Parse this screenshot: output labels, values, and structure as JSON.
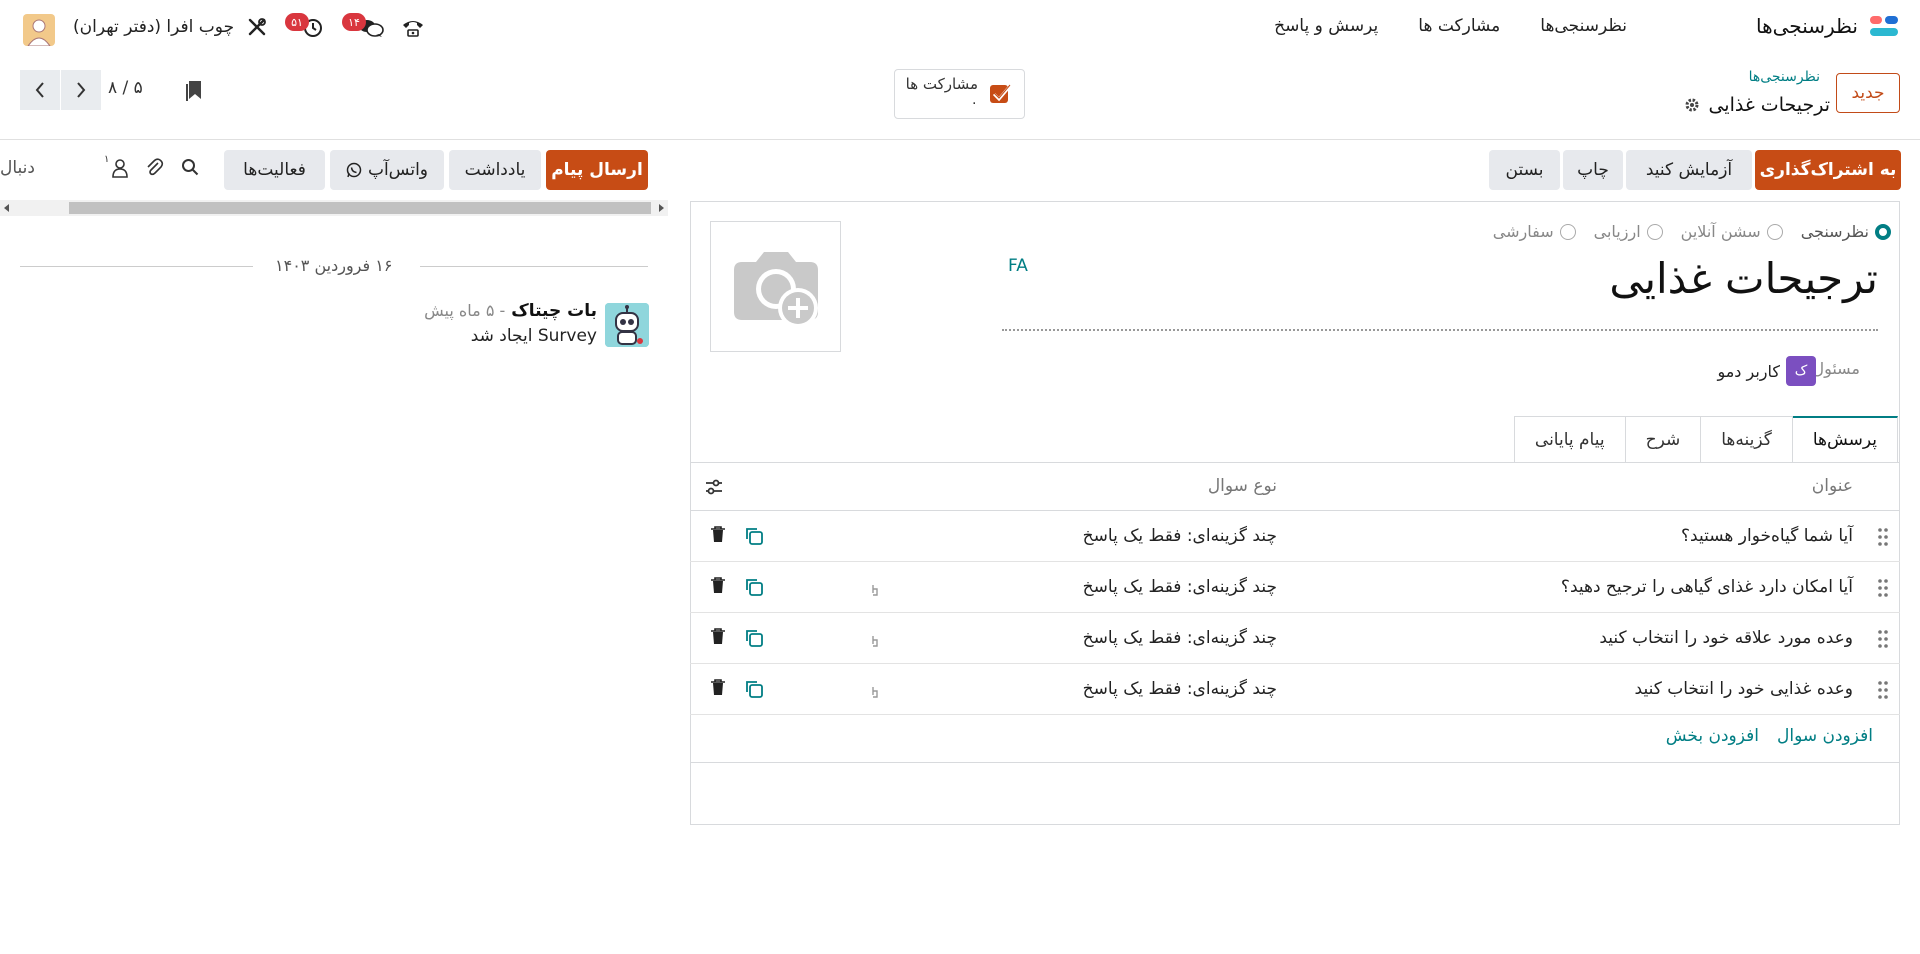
{
  "navbar": {
    "app_name": "نظرسنجی‌ها",
    "menu": [
      "نظرسنجی‌ها",
      "مشارکت ها",
      "پرسش و پاسخ"
    ],
    "company": "چوب افرا (دفتر تهران)",
    "activity_badge": "۵۱",
    "messages_badge": "۱۴"
  },
  "control_panel": {
    "new_button": "جدید",
    "breadcrumb_parent": "نظرسنجی‌ها",
    "breadcrumb_current": "ترجیحات غذایی",
    "stat_label": "مشارکت ها",
    "stat_value": "۰",
    "pager": "۸ / ۵"
  },
  "form_actions": [
    "به اشتراک‌گذاری",
    "آزمایش کنید",
    "چاپ",
    "بستن"
  ],
  "form": {
    "types": [
      {
        "label": "نظرسنجی",
        "selected": true
      },
      {
        "label": "سشن آنلاین",
        "selected": false
      },
      {
        "label": "ارزیابی",
        "selected": false
      },
      {
        "label": "سفارشی",
        "selected": false
      }
    ],
    "title": "ترجیحات غذایی",
    "lang": "FA",
    "responsible_label": "مسئول",
    "responsible_initial": "ک",
    "responsible_name": "کاربر دمو",
    "tabs": [
      "پرسش‌ها",
      "گزینه‌ها",
      "شرح",
      "پیام پایانی"
    ],
    "table": {
      "col_title": "عنوان",
      "col_type": "نوع سوال",
      "rows": [
        {
          "title": "آیا شما گیاه‌خوار هستید؟",
          "type": "چند گزینه‌ای: فقط یک پاسخ"
        },
        {
          "title": "آیا امکان دارد غذای گیاهی را ترجیح دهید؟",
          "type": "چند گزینه‌ای: فقط یک پاسخ"
        },
        {
          "title": "وعده مورد علاقه خود را انتخاب کنید",
          "type": "چند گزینه‌ای: فقط یک پاسخ"
        },
        {
          "title": "وعده غذایی خود را انتخاب کنید",
          "type": "چند گزینه‌ای: فقط یک پاسخ"
        }
      ],
      "add_question": "افزودن سوال",
      "add_section": "افزودن بخش"
    }
  },
  "chatter": {
    "send_message": "ارسال پیام",
    "log_note": "یادداشت",
    "whatsapp": "واتس‌آپ",
    "activities": "فعالیت‌ها",
    "followers_count": "۱",
    "follow": "دنبال",
    "date": "۱۶ فروردین ۱۴۰۳",
    "message": {
      "author": "بات چیتاک",
      "time": "- ۵ ماه پیش",
      "body": "Survey ایجاد شد"
    }
  }
}
